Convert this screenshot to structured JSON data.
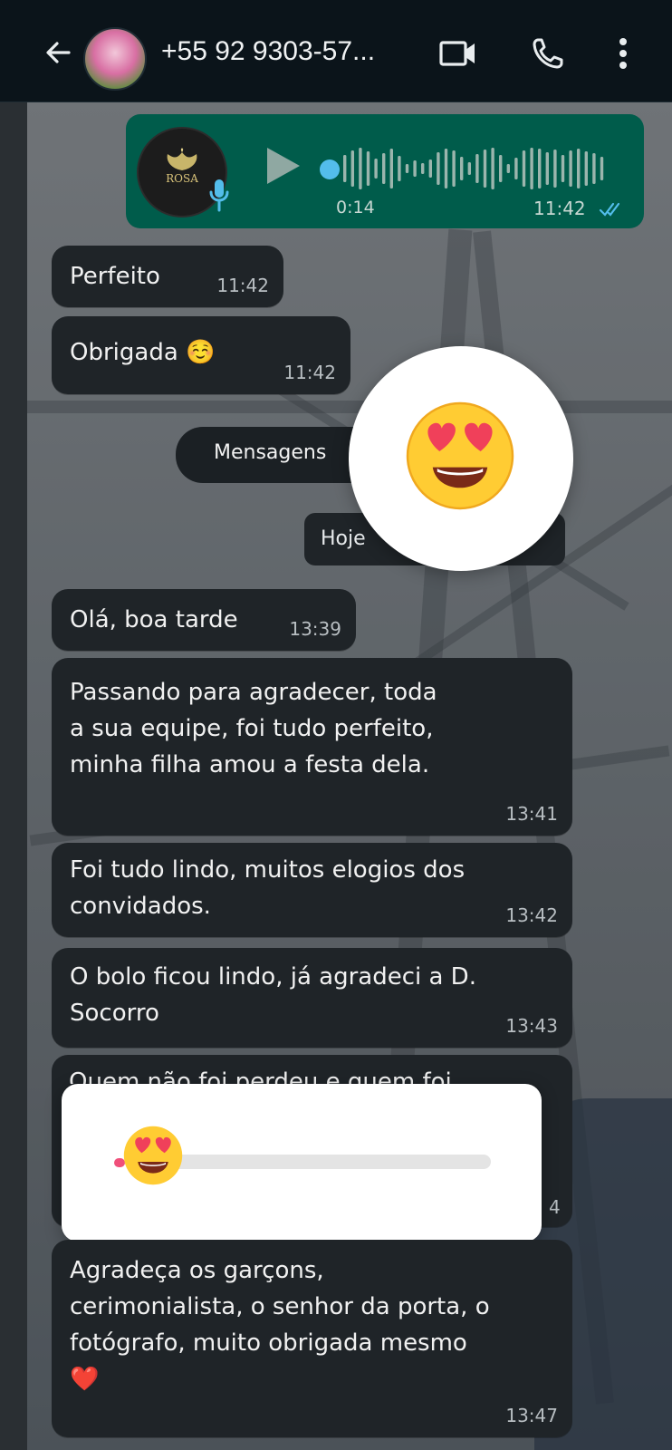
{
  "header": {
    "contact_name": "+55 92 9303-57...",
    "icons": [
      "back-arrow-icon",
      "avatar",
      "video-call-icon",
      "phone-call-icon",
      "more-options-icon"
    ]
  },
  "voice_message": {
    "duration": "0:14",
    "time": "11:42",
    "status": "read",
    "avatar_text": "ROSA",
    "accent_color": "#53bdeb",
    "bubble_color": "#005c4b"
  },
  "messages_before": [
    {
      "text": "Perfeito",
      "time": "11:42"
    },
    {
      "text": "Obrigada ☺️",
      "time": "11:42"
    }
  ],
  "unread_divider": "Mensagens",
  "date_chip": "Hoje",
  "messages_today": [
    {
      "text": "Olá, boa tarde",
      "time": "13:39"
    },
    {
      "text": "Passando para agradecer, toda\na sua equipe, foi tudo perfeito,\nminha filha amou a festa dela.",
      "time": "13:41"
    },
    {
      "text": "Foi tudo lindo, muitos elogios dos\nconvidados.",
      "time": "13:42"
    },
    {
      "text": "O bolo ficou lindo, já agradeci a D.\nSocorro",
      "time": "13:43"
    },
    {
      "text": "Quem não foi perdeu e quem foi",
      "time": "4"
    },
    {
      "text": "Agradeça os garçons,\ncerimonialista, o senhor da porta, o\nfotógrafo, muito obrigada mesmo\n❤️",
      "time": "13:47"
    }
  ],
  "overlays": {
    "reaction_emoji": "heart-eyes-emoji",
    "slider_emoji": "heart-eyes-emoji",
    "slider_level": 0.0
  }
}
